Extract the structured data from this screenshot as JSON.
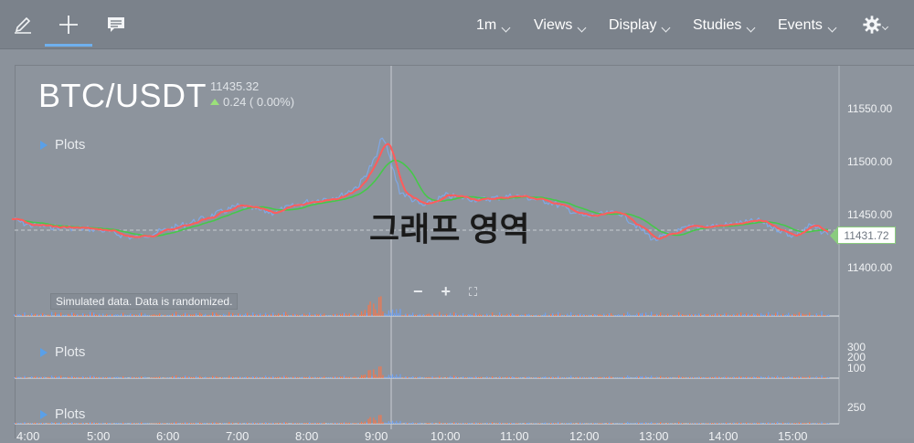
{
  "toolbar": {
    "tools": [
      {
        "name": "pencil-icon"
      },
      {
        "name": "crosshair-icon"
      },
      {
        "name": "comment-icon"
      }
    ],
    "menus": [
      {
        "label": "1m"
      },
      {
        "label": "Views"
      },
      {
        "label": "Display"
      },
      {
        "label": "Studies"
      },
      {
        "label": "Events"
      }
    ],
    "settings_icon": "gear-icon"
  },
  "chart": {
    "symbol": "BTC/USDT",
    "last_price": "11435.32",
    "change": "0.24 ( 0.00%)",
    "plots_label": "Plots",
    "sim_note": "Simulated data.  Data is randomized.",
    "area_label": "그래프 영역",
    "current_price_tag": "11431.72",
    "zoom_out": "−",
    "zoom_in": "+",
    "colors": {
      "price": "#7fa8e6",
      "ma_fast": "#ff5c5c",
      "ma_slow": "#46c84a",
      "vol_up": "#f07850",
      "vol_down": "#6fa0f0"
    }
  },
  "chart_data": {
    "type": "line",
    "title": "BTC/USDT",
    "x_ticks": [
      "4:00",
      "5:00",
      "6:00",
      "7:00",
      "8:00",
      "9:00",
      "10:00",
      "11:00",
      "12:00",
      "13:00",
      "14:00",
      "15:00"
    ],
    "y_ticks": [
      "11550.00",
      "11500.00",
      "11450.00",
      "11400.00"
    ],
    "y_range": [
      11380,
      11575
    ],
    "volume_ticks_a": [
      "300",
      "200",
      "100"
    ],
    "volume_ticks_b": [
      "250"
    ],
    "series": [
      {
        "name": "price",
        "x": [
          "3:45",
          "4:00",
          "4:30",
          "5:00",
          "5:30",
          "6:00",
          "6:30",
          "7:00",
          "7:30",
          "8:00",
          "8:30",
          "8:45",
          "9:00",
          "9:05",
          "9:10",
          "9:20",
          "9:40",
          "10:00",
          "10:30",
          "11:00",
          "11:30",
          "12:00",
          "12:30",
          "13:00",
          "13:30",
          "14:00",
          "14:30",
          "15:00",
          "15:15",
          "15:30"
        ],
        "values": [
          11446,
          11440,
          11438,
          11436,
          11428,
          11436,
          11446,
          11458,
          11452,
          11462,
          11468,
          11478,
          11505,
          11525,
          11508,
          11472,
          11458,
          11468,
          11464,
          11468,
          11462,
          11448,
          11452,
          11426,
          11438,
          11440,
          11444,
          11430,
          11440,
          11431
        ]
      }
    ]
  }
}
